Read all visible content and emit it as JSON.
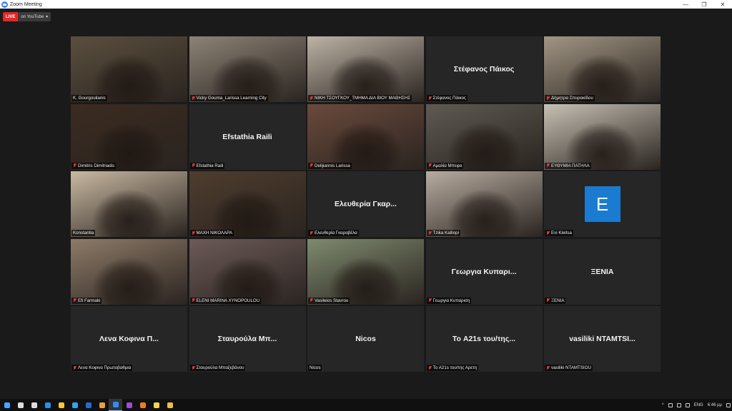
{
  "window": {
    "title": "Zoom Meeting",
    "controls": [
      "—",
      "❐",
      "✕"
    ]
  },
  "live": {
    "badge": "LIVE",
    "destination": "on YouTube",
    "arrow": "▾"
  },
  "participants": [
    {
      "label": "K. Gourgoulianis",
      "muted": false,
      "active": true,
      "bg": "#5b4f3e"
    },
    {
      "label": "Vicky Gouma_Larissa Learning City",
      "muted": true,
      "bg": "#8d8376"
    },
    {
      "label": "ΝΙΚΗ ΤΣΟΥΓΚΟΥ_ΤΜΗΜΑ ΔΙΑ ΒΙΟΥ ΜΑΘΗΣΗΣ",
      "muted": true,
      "bg": "#bdb3a6"
    },
    {
      "label": "Στέφανος Πάικος",
      "display_name": "Στέφανος Πάικος",
      "muted": true
    },
    {
      "label": "Δήμητρα Σπυρακίδου",
      "muted": true,
      "bg": "#a29684"
    },
    {
      "label": "Dimitris Dimitriadis",
      "muted": true,
      "bg": "#3b2b20"
    },
    {
      "label": "Efstathia Raili",
      "display_name": "Efstathia Raili",
      "muted": true
    },
    {
      "label": "Delijiannis Larissa",
      "muted": true,
      "bg": "#6a4a3c"
    },
    {
      "label": "Αμαλία Μπεφα",
      "muted": true,
      "bg": "#5f5a52"
    },
    {
      "label": "ΕΥΘΥΜΙΑ ΠΑΤΗΛΑ",
      "muted": true,
      "bg": "#c7c0b4"
    },
    {
      "label": "Konstantia",
      "muted": false,
      "bg": "#c9b9a2"
    },
    {
      "label": "ΜΑΧΗ ΝΙΚΟΛΑΡΑ",
      "muted": true,
      "bg": "#4f3d2e"
    },
    {
      "label": "Ελευθερία Γκαραβέλα",
      "display_name": "Ελευθερία Γκαρ...",
      "muted": true
    },
    {
      "label": "Tzika Kalliopi",
      "muted": true,
      "bg": "#b7aca0"
    },
    {
      "label": "Evi Kleitsa",
      "avatar_letter": "E",
      "muted": true
    },
    {
      "label": "Efi Farmaki",
      "muted": true,
      "bg": "#8e7b68"
    },
    {
      "label": "ELENI MARINA XYNOPOULOU",
      "muted": true,
      "bg": "#6c5a58"
    },
    {
      "label": "Vasileios Stavrou",
      "muted": true,
      "bg": "#7e8a6e"
    },
    {
      "label": "Γεωργια Κυπαριση",
      "display_name": "Γεωργια Κυπαρι...",
      "muted": true
    },
    {
      "label": "ΞΕΝΙΑ",
      "display_name": "ΞΕΝΙΑ",
      "muted": true
    },
    {
      "label": "Λενα Κοφινα Πρωτοβαθμια",
      "display_name": "Λενα Κοφινα Π...",
      "muted": true
    },
    {
      "label": "Σταυρούλα Μπαξεβάνου",
      "display_name": "Σταυρούλα Μπ...",
      "muted": true
    },
    {
      "label": "Nicos",
      "display_name": "Nicos",
      "muted": false
    },
    {
      "label": "Το A21s του/της Αρετη",
      "display_name": "Το A21s του/της...",
      "muted": true
    },
    {
      "label": "vasiliki NTAMTSIOU",
      "display_name": "vasiliki NTAMTSI...",
      "muted": true
    }
  ],
  "taskbar": {
    "apps": [
      {
        "name": "start-icon",
        "color": "#4aa3ff"
      },
      {
        "name": "search-icon",
        "color": "#dddddd"
      },
      {
        "name": "task-view-icon",
        "color": "#dddddd"
      },
      {
        "name": "edge-icon",
        "color": "#2b8fe0"
      },
      {
        "name": "file-explorer-icon",
        "color": "#f2c744"
      },
      {
        "name": "ie-icon",
        "color": "#3aa0e8"
      },
      {
        "name": "outlook-icon",
        "color": "#1e6fd0"
      },
      {
        "name": "chrome-icon",
        "color": "#e9a23b"
      },
      {
        "name": "zoom-icon",
        "color": "#2d8cff",
        "active": true
      },
      {
        "name": "app-icon",
        "color": "#9a4fd0"
      },
      {
        "name": "firefox-icon",
        "color": "#f07a2a"
      },
      {
        "name": "notes-icon",
        "color": "#f4d64a"
      },
      {
        "name": "paint-icon",
        "color": "#e8c04a"
      }
    ],
    "tray": {
      "chevron": "^",
      "language": "ENG",
      "time": "6:46 μμ"
    }
  }
}
